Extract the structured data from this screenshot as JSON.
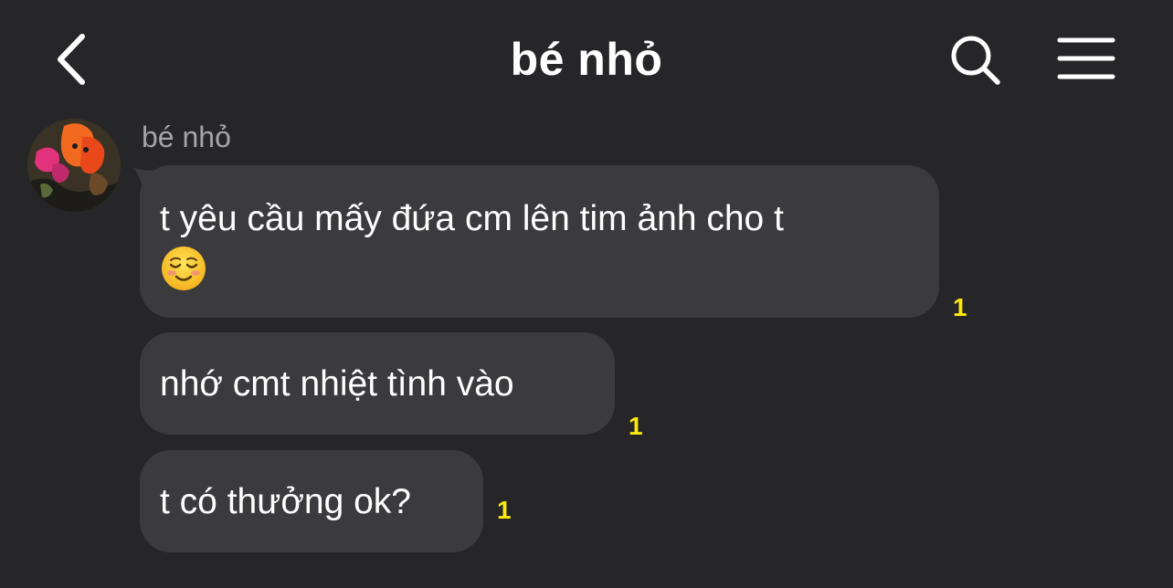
{
  "header": {
    "title": "bé nhỏ",
    "back_icon": "chevron-left-icon",
    "search_icon": "search-icon",
    "menu_icon": "hamburger-menu-icon"
  },
  "sender": {
    "name": "bé nhỏ",
    "avatar": "profile-photo"
  },
  "messages": [
    {
      "text": "t yêu cầu mấy đứa cm lên tim ảnh cho t",
      "emoji": "☺️",
      "unread": "1"
    },
    {
      "text": "nhớ cmt nhiệt tình vào",
      "unread": "1"
    },
    {
      "text": "t có thưởng ok?",
      "unread": "1"
    }
  ],
  "colors": {
    "background": "#262628",
    "bubble": "#3b3b3e",
    "unread_count": "#fce80a",
    "sender_name": "#a5a5a8"
  }
}
